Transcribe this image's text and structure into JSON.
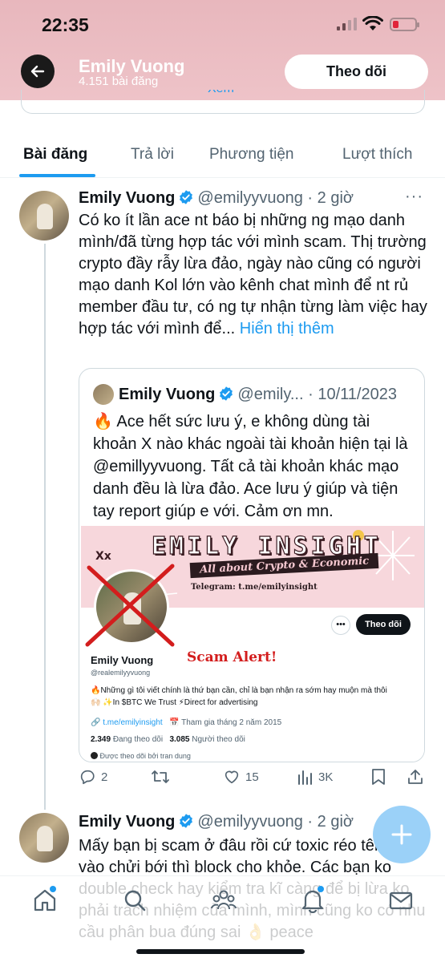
{
  "status_bar": {
    "time": "22:35"
  },
  "header": {
    "name": "Emily Vuong",
    "post_count": "4.151 bài đăng",
    "follow_label": "Theo dõi",
    "peek_text": "Xem"
  },
  "tabs": [
    {
      "label": "Bài đăng",
      "active": true
    },
    {
      "label": "Trả lời",
      "active": false
    },
    {
      "label": "Phương tiện",
      "active": false
    },
    {
      "label": "Lượt thích",
      "active": false
    }
  ],
  "tweet1": {
    "name": "Emily Vuong",
    "handle": "@emilyyvuong",
    "time": "· 2 giờ",
    "more": "···",
    "body": "Có ko ít lần ace nt báo bị những ng mạo danh mình/đã từng hợp tác với mình scam. Thị trường crypto đầy rẫy lừa đảo, ngày nào cũng có người mạo danh Kol lớn vào kênh chat mình để nt rủ member đầu tư, có ng tự nhận từng làm việc hay hợp tác với mình để...",
    "show_more": "Hiển thị thêm",
    "quote": {
      "name": "Emily Vuong",
      "handle": "@emily...",
      "date": "· 10/11/2023",
      "body": "🔥 Ace hết sức lưu ý, e không dùng tài khoản X nào khác ngoài tài khoản hiện tại là @emillyyvuong. Tất cả tài khoản khác mạo danh đều là lừa đảo. Ace lưu ý giúp và tiện tay report giúp e với. Cảm ơn mn.",
      "image": {
        "banner_title": "EMILY INSIGHT",
        "banner_sub": "All about Crypto & Economic",
        "banner_telegram": "Telegram: t.me/emilyinsight",
        "follow_label": "Theo dõi",
        "profile_name": "Emily Vuong",
        "profile_handle": "@realemilyyvuong",
        "scam_label": "Scam Alert!",
        "bio_line1": "🔥Những gì tôi viết chính là thứ bạn cần, chỉ là bạn nhận ra sớm hay muộn mà thôi",
        "bio_line2": "🙌🏻 ✨In $BTC We Trust ⚡Direct for advertising",
        "link": "t.me/emilyinsight",
        "joined": "Tham gia tháng 2 năm 2015",
        "following_count": "2.349",
        "following_label": "Đang theo dõi",
        "followers_count": "3.085",
        "followers_label": "Người theo dõi",
        "followed_by": "Được theo dõi bởi tran dung"
      }
    },
    "actions": {
      "replies": "2",
      "retweets": "",
      "likes": "15",
      "views": "3K"
    }
  },
  "tweet2": {
    "name": "Emily Vuong",
    "handle": "@emilyyvuong",
    "time": "· 2 giờ",
    "body": "Mấy bạn bị scam ở đâu rồi cứ toxic réo tên mình vào chửi bới thì block cho khỏe. Các bạn ko double check hay kiểm tra kĩ càng để bị lừa ko phải trách nhiệm của mình, mình cũng ko có nhu cầu phân bua đúng sai 👌 peace"
  },
  "colors": {
    "accent": "#1d9bf0",
    "header_tint": "#e8b7bd",
    "scam_red": "#d31d1d"
  },
  "icons": [
    "back-arrow-icon",
    "verified-badge-icon",
    "reply-icon",
    "retweet-icon",
    "like-icon",
    "views-icon",
    "bookmark-icon",
    "share-icon",
    "compose-icon",
    "home-icon",
    "search-icon",
    "communities-icon",
    "notifications-icon",
    "messages-icon"
  ]
}
